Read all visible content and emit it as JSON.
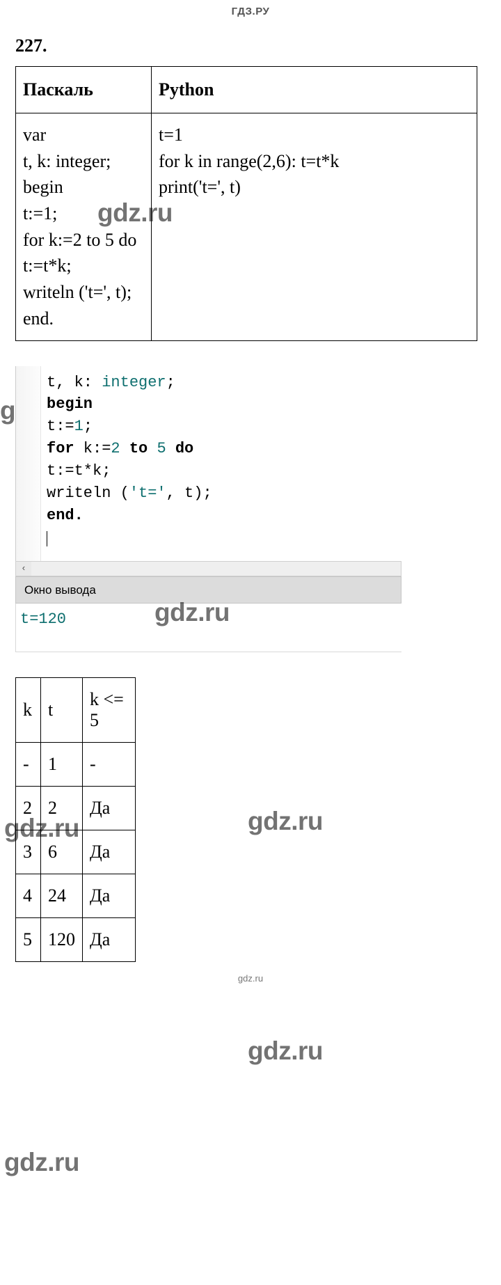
{
  "header": {
    "site": "ГДЗ.РУ"
  },
  "exercise": {
    "number": "227."
  },
  "watermarks": {
    "text": "gdz.ru"
  },
  "footer": {
    "site": "gdz.ru"
  },
  "table1": {
    "headers": {
      "pascal": "Паскаль",
      "python": "Python"
    },
    "pascal_code": {
      "l1": "var",
      "l2": "t, k: integer;",
      "l3": "begin",
      "l4": "t:=1;",
      "l5": "for k:=2 to 5 do",
      "l6": "t:=t*k;",
      "l7": "writeln ('t=', t);",
      "l8": "end."
    },
    "python_code": {
      "l1": "t=1",
      "l2": "for k in range(2,6): t=t*k",
      "l3": "print('t=', t)"
    }
  },
  "editor": {
    "scroll_left": "‹",
    "code": {
      "l1a": "t, k: ",
      "l1b": "integer",
      "l1c": ";",
      "l2": "begin",
      "l3a": "t:=",
      "l3b": "1",
      "l3c": ";",
      "l4a": "for",
      "l4b": " k:=",
      "l4c": "2",
      "l4d": " ",
      "l4e": "to",
      "l4f": " ",
      "l4g": "5",
      "l4h": " ",
      "l4i": "do",
      "l5": "t:=t*k;",
      "l6a": "writeln (",
      "l6b": "'t='",
      "l6c": ", t);",
      "l7": "end."
    },
    "output_title": "Окно вывода",
    "output_text": "t=120"
  },
  "trace": {
    "headers": {
      "k": "k",
      "t": "t",
      "cond": "k <= 5"
    },
    "rows": [
      {
        "k": "-",
        "t": "1",
        "cond": "-"
      },
      {
        "k": "2",
        "t": "2",
        "cond": "Да"
      },
      {
        "k": "3",
        "t": "6",
        "cond": "Да"
      },
      {
        "k": "4",
        "t": "24",
        "cond": "Да"
      },
      {
        "k": "5",
        "t": "120",
        "cond": "Да"
      }
    ]
  }
}
